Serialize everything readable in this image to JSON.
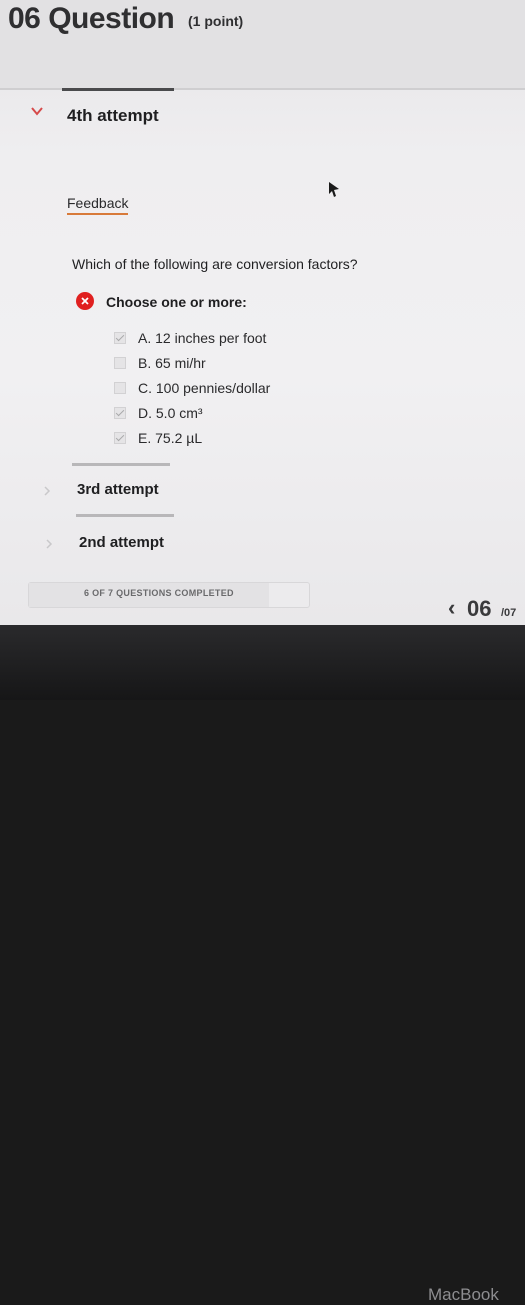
{
  "question": {
    "number_title": "06 Question",
    "points": "(1 point)",
    "text": "Which of the following are conversion factors?"
  },
  "current_attempt": {
    "label": "4th attempt",
    "feedback_tab": "Feedback",
    "choose_label": "Choose one or more:",
    "options": [
      {
        "label": "A.",
        "text": "12 inches per foot",
        "checked": true
      },
      {
        "label": "B.",
        "text": "65 mi/hr",
        "checked": false
      },
      {
        "label": "C.",
        "text": "100 pennies/dollar",
        "checked": false
      },
      {
        "label": "D.",
        "text": "5.0 cm³",
        "checked": true
      },
      {
        "label": "E.",
        "text": "75.2 µL",
        "checked": true
      }
    ]
  },
  "previous_attempts": [
    "3rd attempt",
    "2nd attempt"
  ],
  "progress": {
    "text": "6 OF 7 QUESTIONS COMPLETED",
    "fraction": 0.857
  },
  "nav": {
    "prev_symbol": "‹",
    "current": "06",
    "total": "/07"
  },
  "device_brand": "MacBook",
  "colors": {
    "error": "#e02020",
    "feedback_underline": "#d87a3a"
  },
  "icons": {
    "collapse": "chevron-down-icon",
    "expand": "chevron-right-icon",
    "status": "wrong-answer-icon",
    "pointer": "mouse-cursor-icon"
  }
}
